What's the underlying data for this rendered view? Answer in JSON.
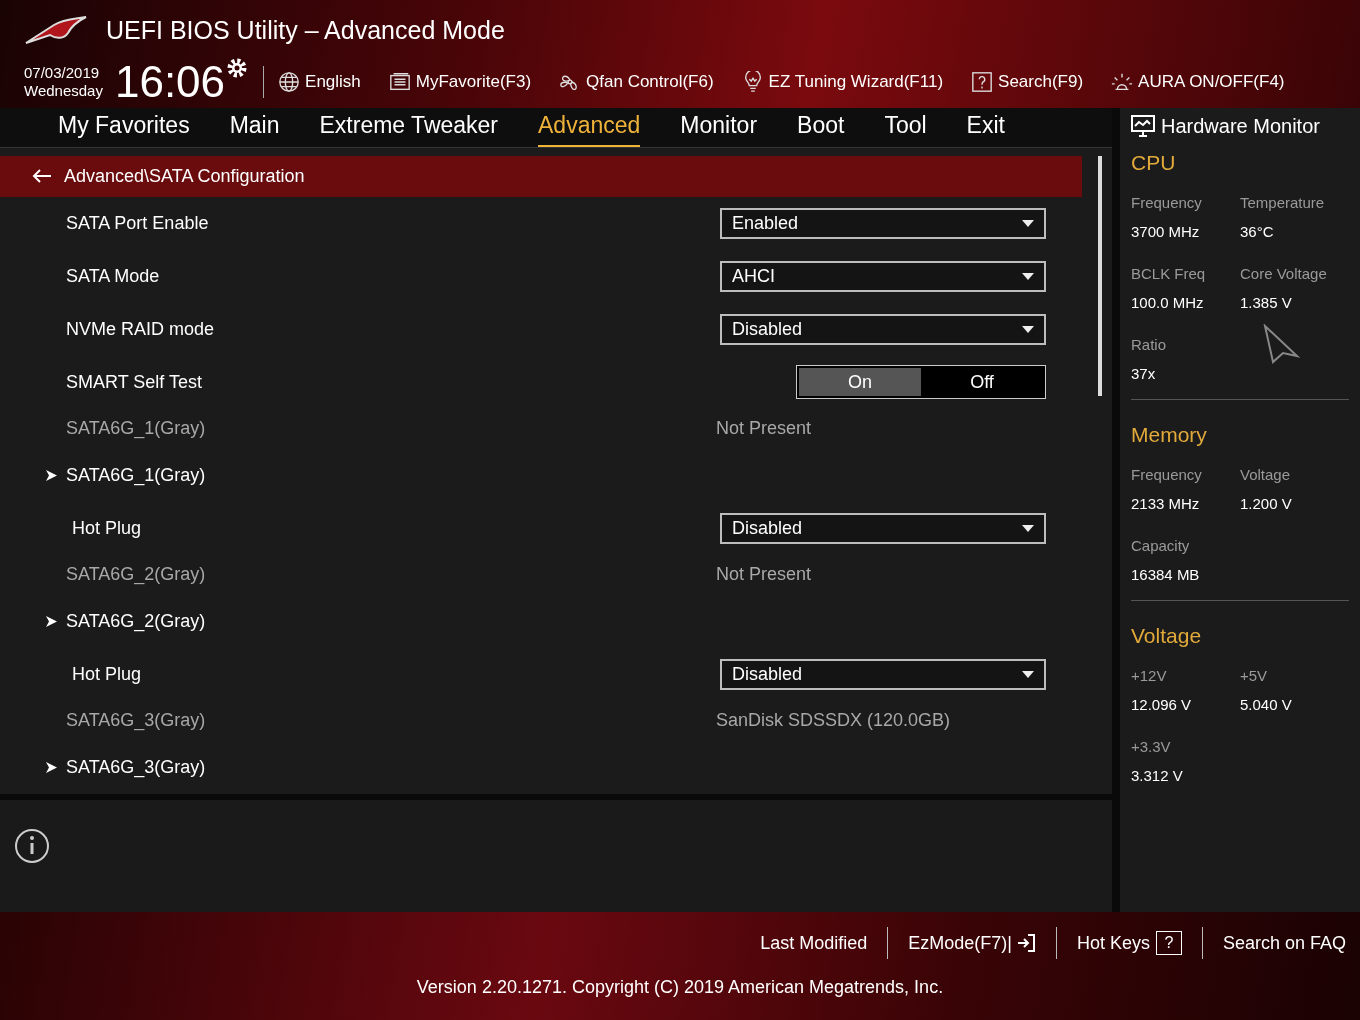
{
  "window": {
    "title": "UEFI BIOS Utility – Advanced Mode"
  },
  "clock": {
    "date": "07/03/2019",
    "weekday": "Wednesday",
    "time": "16:06"
  },
  "toolbar": [
    {
      "kind": "language",
      "label": "English"
    },
    {
      "kind": "favorite",
      "label": "MyFavorite(F3)"
    },
    {
      "kind": "fan",
      "label": "Qfan Control(F6)"
    },
    {
      "kind": "wizard",
      "label": "EZ Tuning Wizard(F11)"
    },
    {
      "kind": "search",
      "label": "Search(F9)"
    },
    {
      "kind": "aura",
      "label": "AURA ON/OFF(F4)"
    }
  ],
  "tabs": [
    {
      "label": "My Favorites",
      "selected": false
    },
    {
      "label": "Main",
      "selected": false
    },
    {
      "label": "Extreme Tweaker",
      "selected": false
    },
    {
      "label": "Advanced",
      "selected": true
    },
    {
      "label": "Monitor",
      "selected": false
    },
    {
      "label": "Boot",
      "selected": false
    },
    {
      "label": "Tool",
      "selected": false
    },
    {
      "label": "Exit",
      "selected": false
    }
  ],
  "breadcrumb": "Advanced\\SATA Configuration",
  "settings": [
    {
      "kind": "dropdown",
      "label": "SATA Port Enable",
      "value": "Enabled"
    },
    {
      "kind": "dropdown",
      "label": "SATA Mode",
      "value": "AHCI"
    },
    {
      "kind": "dropdown",
      "label": "NVMe RAID mode",
      "value": "Disabled"
    },
    {
      "kind": "toggle",
      "label": "SMART Self Test",
      "on_label": "On",
      "off_label": "Off",
      "on": true
    },
    {
      "kind": "info",
      "label": "SATA6G_1(Gray)",
      "value": "Not Present"
    },
    {
      "kind": "submenu",
      "label": "SATA6G_1(Gray)",
      "children": [
        {
          "kind": "dropdown",
          "label": "Hot Plug",
          "value": "Disabled"
        }
      ]
    },
    {
      "kind": "info",
      "label": "SATA6G_2(Gray)",
      "value": "Not Present"
    },
    {
      "kind": "submenu",
      "label": "SATA6G_2(Gray)",
      "children": [
        {
          "kind": "dropdown",
          "label": "Hot Plug",
          "value": "Disabled"
        }
      ]
    },
    {
      "kind": "info",
      "label": "SATA6G_3(Gray)",
      "value": "SanDisk SDSSDX (120.0GB)"
    },
    {
      "kind": "submenu",
      "label": "SATA6G_3(Gray)"
    }
  ],
  "hardware_monitor": {
    "title": "Hardware Monitor",
    "sections": [
      {
        "title": "CPU",
        "items": [
          {
            "label": "Frequency",
            "value": "3700 MHz"
          },
          {
            "label": "Temperature",
            "value": "36°C"
          },
          {
            "label": "BCLK Freq",
            "value": "100.0 MHz"
          },
          {
            "label": "Core Voltage",
            "value": "1.385 V"
          },
          {
            "label": "Ratio",
            "value": "37x"
          }
        ]
      },
      {
        "title": "Memory",
        "items": [
          {
            "label": "Frequency",
            "value": "2133 MHz"
          },
          {
            "label": "Voltage",
            "value": "1.200 V"
          },
          {
            "label": "Capacity",
            "value": "16384 MB"
          }
        ]
      },
      {
        "title": "Voltage",
        "items": [
          {
            "label": "+12V",
            "value": "12.096 V"
          },
          {
            "label": "+5V",
            "value": "5.040 V"
          },
          {
            "label": "+3.3V",
            "value": "3.312 V"
          }
        ]
      }
    ]
  },
  "footer": {
    "links": [
      {
        "kind": "text",
        "label": "Last Modified"
      },
      {
        "kind": "ezmode",
        "label": "EzMode(F7)|"
      },
      {
        "kind": "hotkeys",
        "label": "Hot Keys",
        "key": "?"
      },
      {
        "kind": "text",
        "label": "Search on FAQ"
      }
    ],
    "version": "Version 2.20.1271. Copyright (C) 2019 American Megatrends, Inc."
  }
}
